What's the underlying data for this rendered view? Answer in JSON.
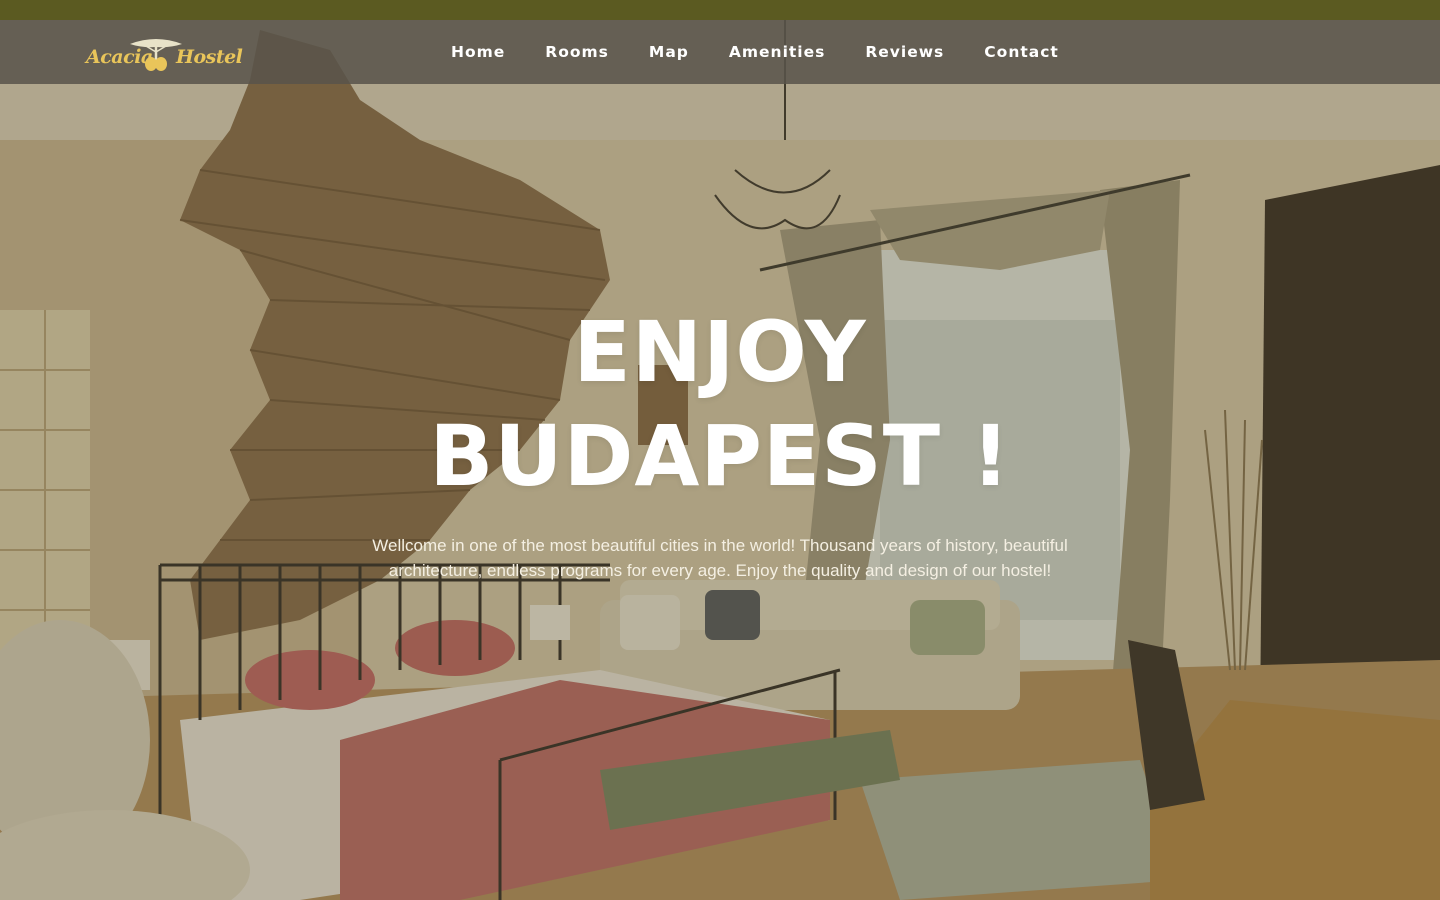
{
  "brand": {
    "name_part1": "Acacia",
    "name_part2": "Hostel",
    "color": "#e9c55a"
  },
  "nav": {
    "items": [
      {
        "label": "Home"
      },
      {
        "label": "Rooms"
      },
      {
        "label": "Map"
      },
      {
        "label": "Amenities"
      },
      {
        "label": "Reviews"
      },
      {
        "label": "Contact"
      }
    ]
  },
  "hero": {
    "title_line1": "ENJOY",
    "title_line2": "BUDAPEST !",
    "description": "Wellcome in one of the most beautiful cities in the world! Thousand years of history, beautiful architecture, endless programs for every age. Enjoy the quality and design of our hostel!"
  },
  "colors": {
    "top_strip": "#5b5a21",
    "navbar": "#58544a",
    "text": "#ffffff"
  }
}
